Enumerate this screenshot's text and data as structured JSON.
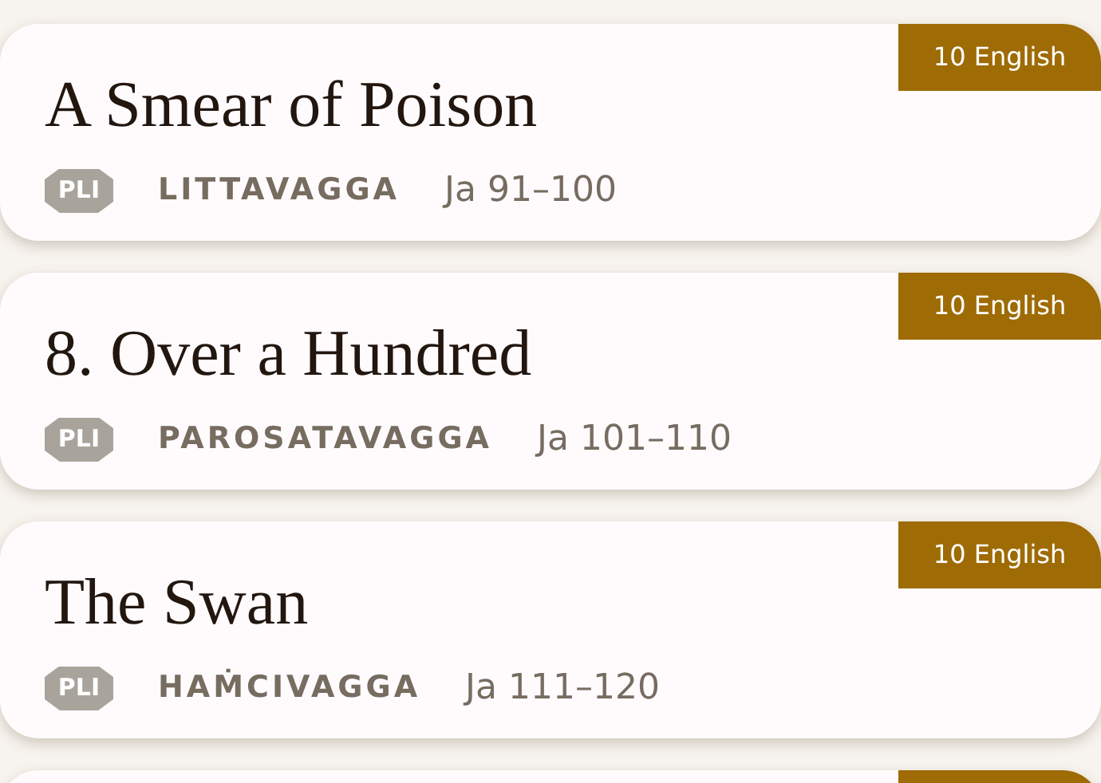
{
  "cards": [
    {
      "title": "A Smear of Poison",
      "badge": "10 English",
      "language": "PLI",
      "vagga": "LITTAVAGGA",
      "range": "Ja 91–100"
    },
    {
      "title": "8. Over a Hundred",
      "badge": "10 English",
      "language": "PLI",
      "vagga": "PAROSATAVAGGA",
      "range": "Ja 101–110"
    },
    {
      "title": "The Swan",
      "badge": "10 English",
      "language": "PLI",
      "vagga": "HAṀCIVAGGA",
      "range": "Ja 111–120"
    }
  ]
}
